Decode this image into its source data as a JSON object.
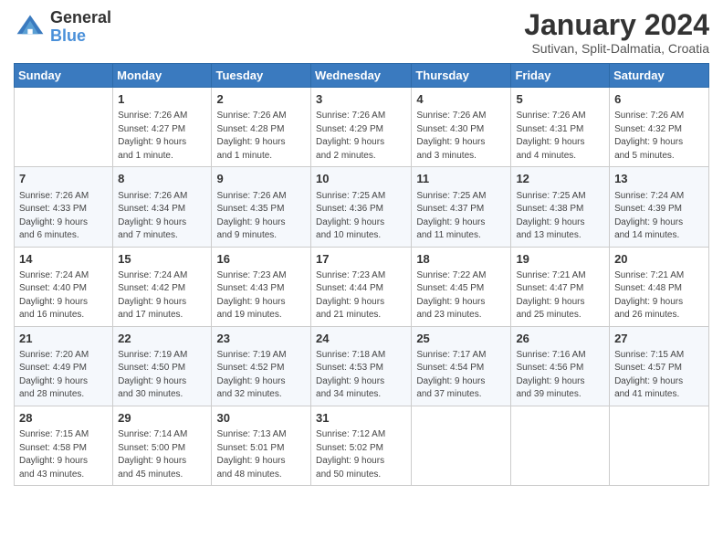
{
  "logo": {
    "general": "General",
    "blue": "Blue"
  },
  "header": {
    "month": "January 2024",
    "location": "Sutivan, Split-Dalmatia, Croatia"
  },
  "weekdays": [
    "Sunday",
    "Monday",
    "Tuesday",
    "Wednesday",
    "Thursday",
    "Friday",
    "Saturday"
  ],
  "weeks": [
    [
      {
        "day": "",
        "info": ""
      },
      {
        "day": "1",
        "info": "Sunrise: 7:26 AM\nSunset: 4:27 PM\nDaylight: 9 hours\nand 1 minute."
      },
      {
        "day": "2",
        "info": "Sunrise: 7:26 AM\nSunset: 4:28 PM\nDaylight: 9 hours\nand 1 minute."
      },
      {
        "day": "3",
        "info": "Sunrise: 7:26 AM\nSunset: 4:29 PM\nDaylight: 9 hours\nand 2 minutes."
      },
      {
        "day": "4",
        "info": "Sunrise: 7:26 AM\nSunset: 4:30 PM\nDaylight: 9 hours\nand 3 minutes."
      },
      {
        "day": "5",
        "info": "Sunrise: 7:26 AM\nSunset: 4:31 PM\nDaylight: 9 hours\nand 4 minutes."
      },
      {
        "day": "6",
        "info": "Sunrise: 7:26 AM\nSunset: 4:32 PM\nDaylight: 9 hours\nand 5 minutes."
      }
    ],
    [
      {
        "day": "7",
        "info": "Sunrise: 7:26 AM\nSunset: 4:33 PM\nDaylight: 9 hours\nand 6 minutes."
      },
      {
        "day": "8",
        "info": "Sunrise: 7:26 AM\nSunset: 4:34 PM\nDaylight: 9 hours\nand 7 minutes."
      },
      {
        "day": "9",
        "info": "Sunrise: 7:26 AM\nSunset: 4:35 PM\nDaylight: 9 hours\nand 9 minutes."
      },
      {
        "day": "10",
        "info": "Sunrise: 7:25 AM\nSunset: 4:36 PM\nDaylight: 9 hours\nand 10 minutes."
      },
      {
        "day": "11",
        "info": "Sunrise: 7:25 AM\nSunset: 4:37 PM\nDaylight: 9 hours\nand 11 minutes."
      },
      {
        "day": "12",
        "info": "Sunrise: 7:25 AM\nSunset: 4:38 PM\nDaylight: 9 hours\nand 13 minutes."
      },
      {
        "day": "13",
        "info": "Sunrise: 7:24 AM\nSunset: 4:39 PM\nDaylight: 9 hours\nand 14 minutes."
      }
    ],
    [
      {
        "day": "14",
        "info": "Sunrise: 7:24 AM\nSunset: 4:40 PM\nDaylight: 9 hours\nand 16 minutes."
      },
      {
        "day": "15",
        "info": "Sunrise: 7:24 AM\nSunset: 4:42 PM\nDaylight: 9 hours\nand 17 minutes."
      },
      {
        "day": "16",
        "info": "Sunrise: 7:23 AM\nSunset: 4:43 PM\nDaylight: 9 hours\nand 19 minutes."
      },
      {
        "day": "17",
        "info": "Sunrise: 7:23 AM\nSunset: 4:44 PM\nDaylight: 9 hours\nand 21 minutes."
      },
      {
        "day": "18",
        "info": "Sunrise: 7:22 AM\nSunset: 4:45 PM\nDaylight: 9 hours\nand 23 minutes."
      },
      {
        "day": "19",
        "info": "Sunrise: 7:21 AM\nSunset: 4:47 PM\nDaylight: 9 hours\nand 25 minutes."
      },
      {
        "day": "20",
        "info": "Sunrise: 7:21 AM\nSunset: 4:48 PM\nDaylight: 9 hours\nand 26 minutes."
      }
    ],
    [
      {
        "day": "21",
        "info": "Sunrise: 7:20 AM\nSunset: 4:49 PM\nDaylight: 9 hours\nand 28 minutes."
      },
      {
        "day": "22",
        "info": "Sunrise: 7:19 AM\nSunset: 4:50 PM\nDaylight: 9 hours\nand 30 minutes."
      },
      {
        "day": "23",
        "info": "Sunrise: 7:19 AM\nSunset: 4:52 PM\nDaylight: 9 hours\nand 32 minutes."
      },
      {
        "day": "24",
        "info": "Sunrise: 7:18 AM\nSunset: 4:53 PM\nDaylight: 9 hours\nand 34 minutes."
      },
      {
        "day": "25",
        "info": "Sunrise: 7:17 AM\nSunset: 4:54 PM\nDaylight: 9 hours\nand 37 minutes."
      },
      {
        "day": "26",
        "info": "Sunrise: 7:16 AM\nSunset: 4:56 PM\nDaylight: 9 hours\nand 39 minutes."
      },
      {
        "day": "27",
        "info": "Sunrise: 7:15 AM\nSunset: 4:57 PM\nDaylight: 9 hours\nand 41 minutes."
      }
    ],
    [
      {
        "day": "28",
        "info": "Sunrise: 7:15 AM\nSunset: 4:58 PM\nDaylight: 9 hours\nand 43 minutes."
      },
      {
        "day": "29",
        "info": "Sunrise: 7:14 AM\nSunset: 5:00 PM\nDaylight: 9 hours\nand 45 minutes."
      },
      {
        "day": "30",
        "info": "Sunrise: 7:13 AM\nSunset: 5:01 PM\nDaylight: 9 hours\nand 48 minutes."
      },
      {
        "day": "31",
        "info": "Sunrise: 7:12 AM\nSunset: 5:02 PM\nDaylight: 9 hours\nand 50 minutes."
      },
      {
        "day": "",
        "info": ""
      },
      {
        "day": "",
        "info": ""
      },
      {
        "day": "",
        "info": ""
      }
    ]
  ]
}
